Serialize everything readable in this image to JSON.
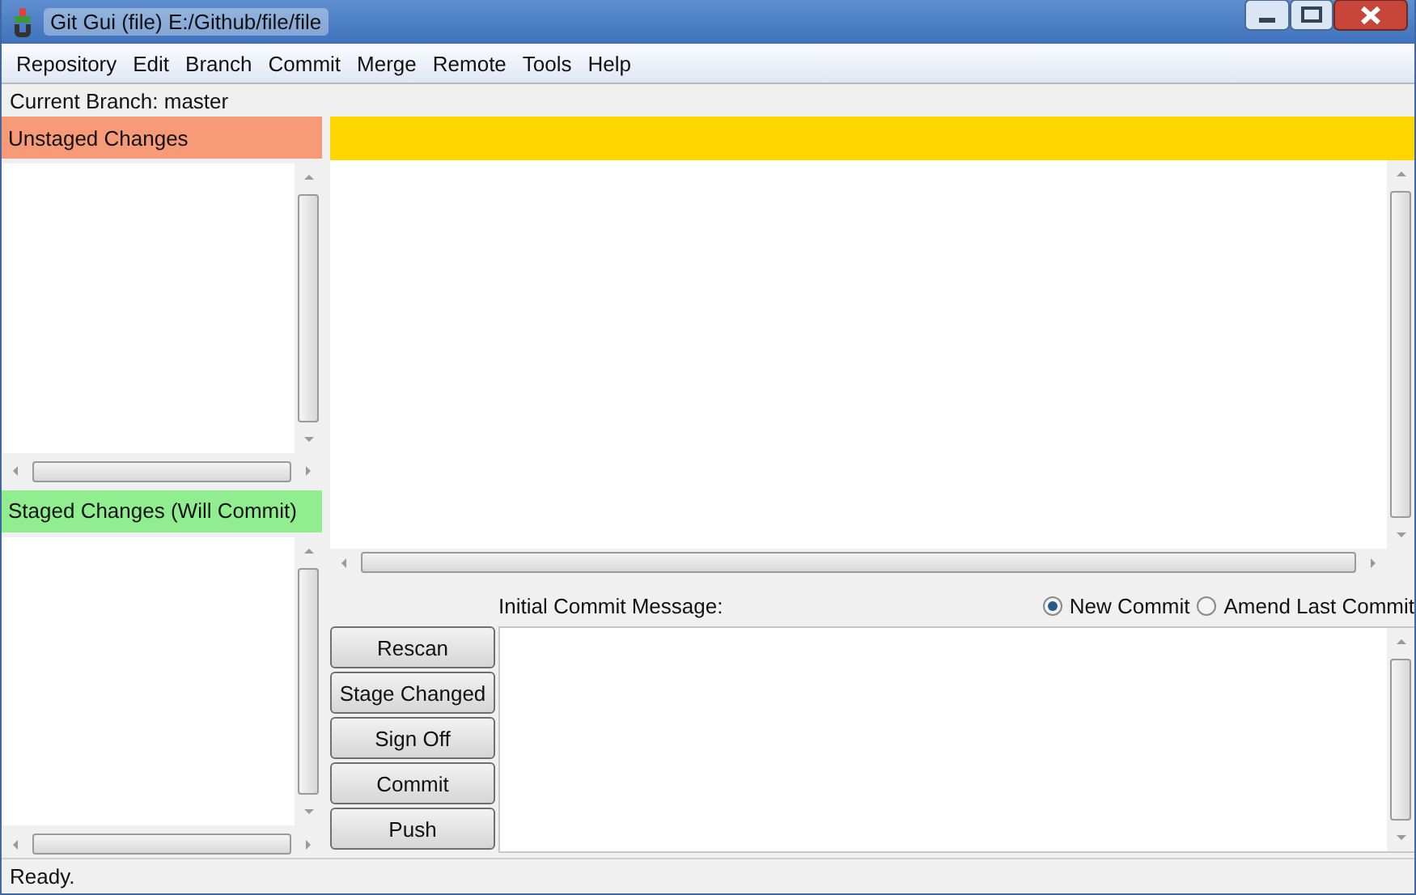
{
  "window": {
    "title": "Git Gui (file) E:/Github/file/file"
  },
  "menu": [
    "Repository",
    "Edit",
    "Branch",
    "Commit",
    "Merge",
    "Remote",
    "Tools",
    "Help"
  ],
  "current_branch": "Current Branch: master",
  "unstaged": {
    "title": "Unstaged Changes"
  },
  "staged": {
    "title": "Staged Changes (Will Commit)"
  },
  "commit": {
    "label": "Initial Commit Message:",
    "modes": [
      {
        "label": "New Commit",
        "selected": true
      },
      {
        "label": "Amend Last Commit",
        "selected": false
      }
    ],
    "buttons": [
      "Rescan",
      "Stage Changed",
      "Sign Off",
      "Commit",
      "Push"
    ]
  },
  "status_bar": "Ready."
}
